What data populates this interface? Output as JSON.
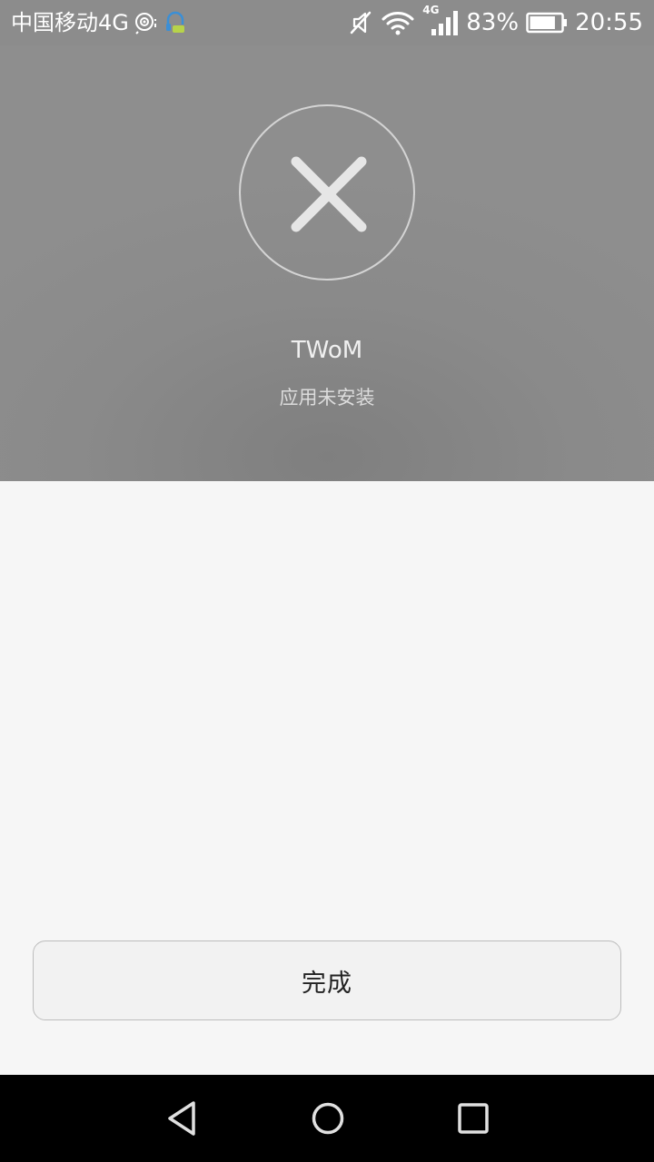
{
  "status_bar": {
    "carrier": "中国移动4G",
    "battery_percent": "83%",
    "battery_level": 0.83,
    "network_badge": "4G",
    "time": "20:55",
    "icons": [
      "hotspot-icon",
      "headset-app-icon",
      "mute-icon",
      "wifi-icon",
      "signal-icon",
      "battery-icon"
    ]
  },
  "result": {
    "icon": "close-icon",
    "app_name": "TWoM",
    "status": "应用未安装"
  },
  "actions": {
    "done_label": "完成"
  },
  "nav": {
    "icons": [
      "back-icon",
      "home-icon",
      "recents-icon"
    ]
  },
  "colors": {
    "header_bg": "#8c8c8c",
    "page_bg": "#f6f6f6",
    "nav_bg": "#000000"
  }
}
